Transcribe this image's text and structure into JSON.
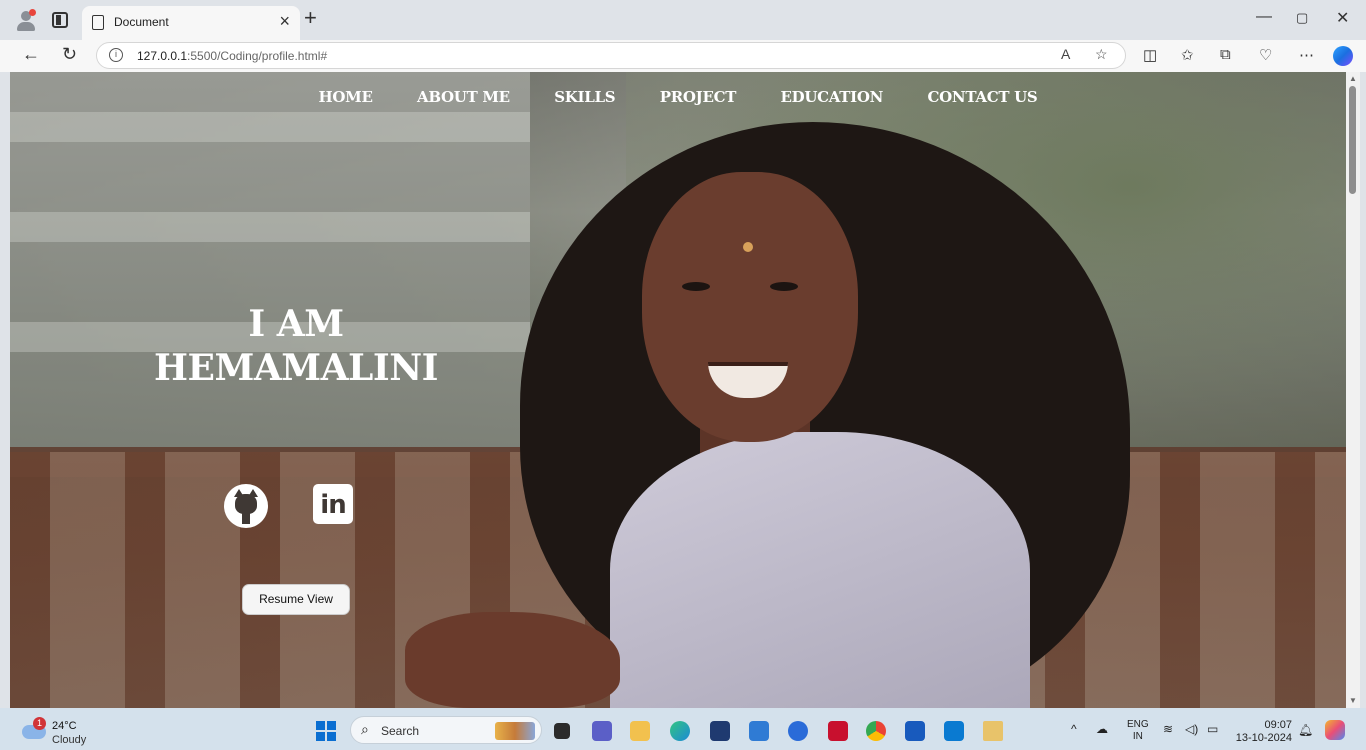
{
  "browser": {
    "tab_title": "Document",
    "url_host": "127.0.0.1",
    "url_path": ":5500/Coding/profile.html#",
    "icons": [
      "profile-icon",
      "tab-actions-icon",
      "document-icon",
      "close-icon",
      "new-tab-icon",
      "minimize-icon",
      "maximize-icon",
      "window-close-icon",
      "back-icon",
      "refresh-icon",
      "info-icon",
      "read-aloud-icon",
      "favorite-star-icon",
      "split-screen-icon",
      "favorites-icon",
      "collections-icon",
      "browser-essentials-icon",
      "more-icon",
      "copilot-icon"
    ]
  },
  "page": {
    "nav": [
      "HOME",
      "ABOUT ME",
      "SKILLS",
      "PROJECT",
      "EDUCATION",
      "CONTACT US"
    ],
    "hero_line1": "I AM",
    "hero_line2": "HEMAMALINI",
    "linkedin_text": "in",
    "resume_button": "Resume View"
  },
  "taskbar": {
    "weather_badge": "1",
    "temperature": "24°C",
    "condition": "Cloudy",
    "search_label": "Search",
    "lang_line1": "ENG",
    "lang_line2": "IN",
    "time": "09:07",
    "date": "13-10-2024"
  },
  "colors": {
    "accent": "#0a6ed1",
    "chrome_bg": "#dfe3e8",
    "taskbar_bg": "#d4e1ec"
  }
}
